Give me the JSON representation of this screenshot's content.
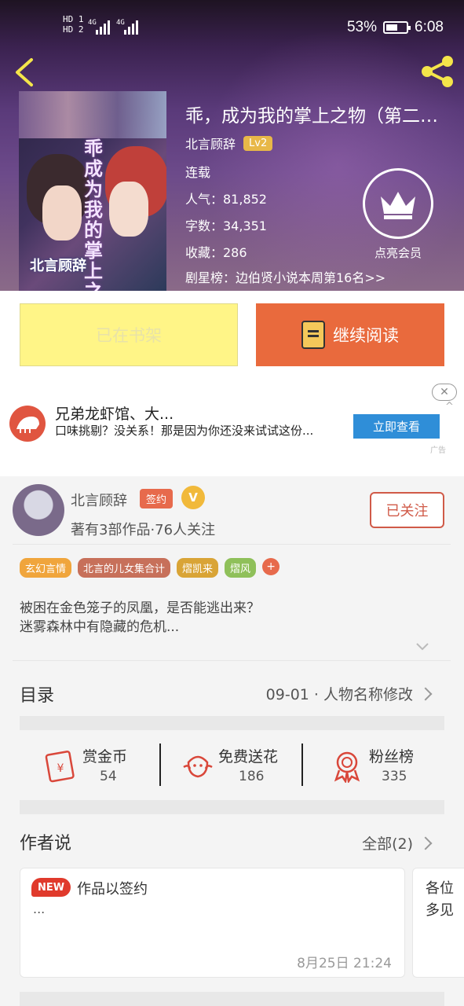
{
  "status_bar": {
    "signal_labels": [
      "HD 1",
      "HD 2"
    ],
    "net1": "4G",
    "net2": "4G",
    "battery": "53%",
    "time": "6:08"
  },
  "book": {
    "title": "乖，成为我的掌上之物（第二…",
    "author": "北言顾辞",
    "level": "Lv2",
    "status": "连载",
    "popularity": "人气：81,852",
    "word_count": "字数：34,351",
    "favorites": "收藏：286",
    "rank": "剧星榜：边伯贤小说本周第16名>>",
    "vip_label": "点亮会员",
    "cover": {
      "vertical_title": "乖成为我的掌上之物",
      "author": "北言顾辞"
    }
  },
  "actions": {
    "shelf_label": "已在书架",
    "read_label": "继续阅读"
  },
  "ad": {
    "title": "兄弟龙虾馆、大...",
    "desc": "口味挑剔？没关系！那是因为你还没来试试这份...",
    "button": "立即查看",
    "close": "✕",
    "collapse": "^",
    "tag": "广告"
  },
  "author_card": {
    "name": "北言顾辞",
    "signed_badge": "签约",
    "v_badge": "V",
    "stats": "著有3部作品·76人关注",
    "follow_label": "已关注"
  },
  "tags": [
    {
      "label": "玄幻言情",
      "color": "#f0a53c"
    },
    {
      "label": "北言的儿女集合计",
      "color": "#c7705a"
    },
    {
      "label": "熠凯来",
      "color": "#d9a436"
    },
    {
      "label": "熠风",
      "color": "#8fc05a"
    }
  ],
  "tag_more": "+",
  "description": {
    "line1": "被困在金色笼子的凤凰，是否能逃出来？",
    "line2": "迷雾森林中有隐藏的危机..."
  },
  "toc": {
    "label": "目录",
    "latest": "09-01 · 人物名称修改"
  },
  "stats": [
    {
      "label": "赏金币",
      "value": "54"
    },
    {
      "label": "免费送花",
      "value": "186"
    },
    {
      "label": "粉丝榜",
      "value": "335"
    }
  ],
  "author_says": {
    "label": "作者说",
    "all": "全部(2)",
    "cards": [
      {
        "badge": "NEW",
        "title": "作品以签约",
        "body": "...",
        "date": "8月25日  21:24"
      },
      {
        "line1": "各位",
        "line2": "多见"
      }
    ]
  },
  "colors": {
    "accent_orange": "#e96a3d",
    "shelf_yellow": "#fff587",
    "ad_blue": "#2f8ed8",
    "badge_red": "#e03a2c"
  }
}
